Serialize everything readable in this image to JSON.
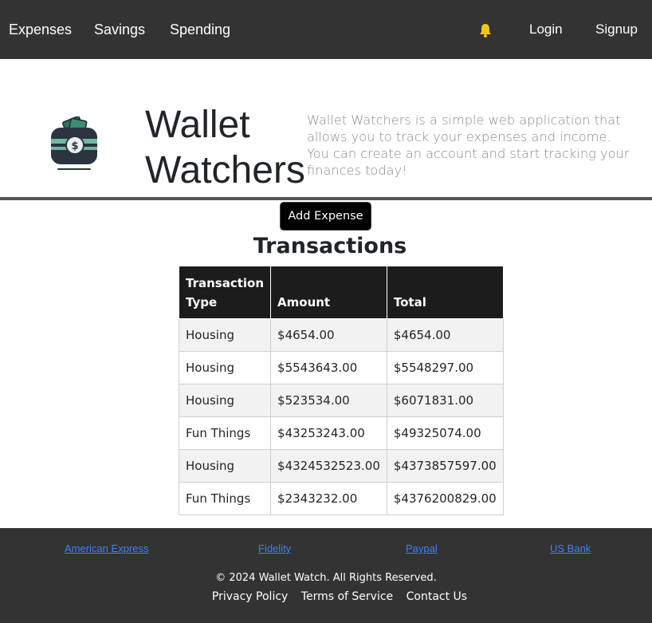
{
  "nav": {
    "left_items": [
      "Expenses",
      "Savings",
      "Spending"
    ],
    "login_label": "Login",
    "signup_label": "Signup",
    "bell_icon": "bell-icon",
    "bell_color": "#f5c518"
  },
  "hero": {
    "brand_line1": "Wallet",
    "brand_line2": "Watchers",
    "description": "Wallet Watchers is a simple web application that allows you to track your expenses and income. You can create an account and start tracking your finances today!",
    "logo_icon": "wallet-icon"
  },
  "actions": {
    "add_expense_label": "Add Expense"
  },
  "transactions": {
    "title": "Transactions",
    "headers": [
      "Transaction Type",
      "Amount",
      "Total"
    ],
    "rows": [
      [
        "Housing",
        "$4654.00",
        "$4654.00"
      ],
      [
        "Housing",
        "$5543643.00",
        "$5548297.00"
      ],
      [
        "Housing",
        "$523534.00",
        "$6071831.00"
      ],
      [
        "Fun Things",
        "$43253243.00",
        "$49325074.00"
      ],
      [
        "Housing",
        "$4324532523.00",
        "$4373857597.00"
      ],
      [
        "Fun Things",
        "$2343232.00",
        "$4376200829.00"
      ]
    ]
  },
  "footer": {
    "links": [
      "American Express",
      "Fidelity",
      "Paypal",
      "US Bank"
    ],
    "copyright": "© 2024 Wallet Watch. All Rights Reserved.",
    "legal_links": [
      "Privacy Policy",
      "Terms of Service",
      "Contact Us"
    ]
  },
  "colors": {
    "navbar_bg": "#333333",
    "footer_bg": "#333333",
    "table_header_bg": "#1c1c1c",
    "link_color": "#3b82f6"
  }
}
